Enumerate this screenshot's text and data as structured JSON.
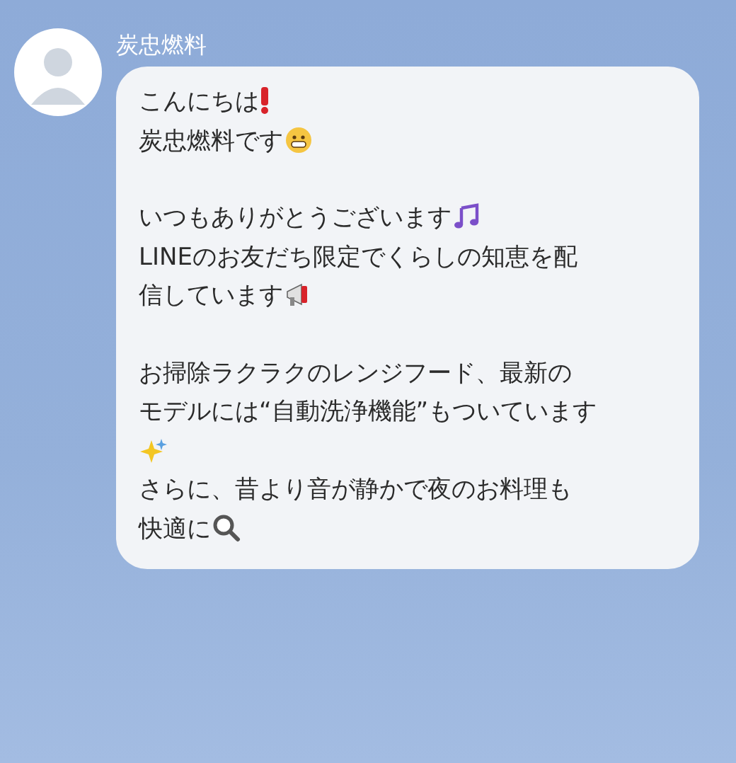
{
  "contact": {
    "name": "炭忠燃料"
  },
  "message": {
    "paragraphs": [
      {
        "lines": [
          "こんにちは",
          "炭忠燃料です"
        ]
      },
      {
        "lines": [
          "いつもありがとうございます",
          "LINEのお友だち限定でくらしの知恵を配",
          "信しています"
        ]
      },
      {
        "lines": [
          "お掃除ラクラクのレンジフード、最新の",
          "モデルには“自動洗浄機能”もついています",
          "さらに、昔より音が静かで夜のお料理も",
          "快適に"
        ]
      }
    ]
  }
}
